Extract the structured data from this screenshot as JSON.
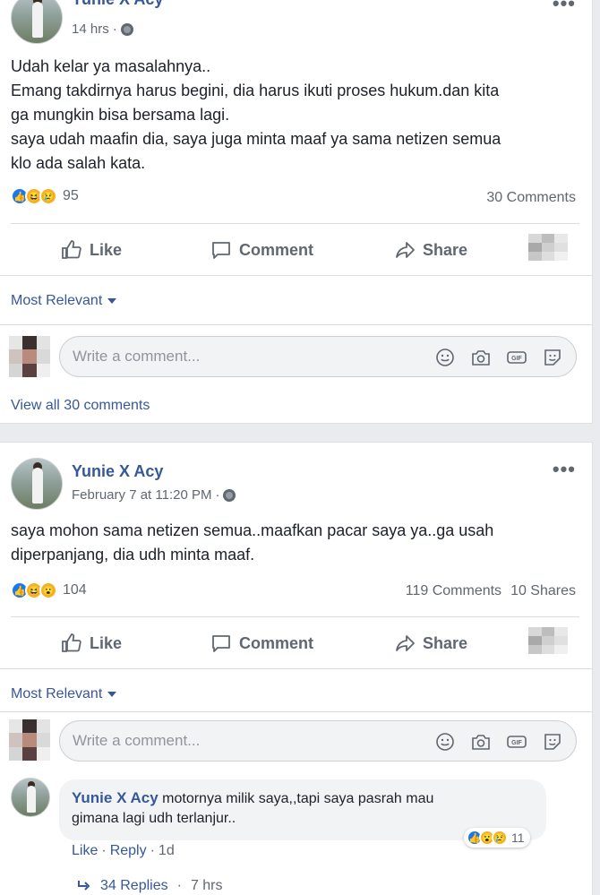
{
  "post1": {
    "author": "Yunie X Acy",
    "time": "14 hrs",
    "more": "•••",
    "body": [
      "Udah kelar ya masalahnya..",
      "Emang takdirnya harus begini, dia harus ikuti proses hukum.dan kita",
      "ga mungkin bisa bersama lagi.",
      "saya udah maafin dia, saya juga minta maaf ya sama netizen semua",
      "klo ada salah kata."
    ],
    "reaction_count": "95",
    "comments_count": "30 Comments",
    "actions": {
      "like": "Like",
      "comment": "Comment",
      "share": "Share"
    },
    "sort_label": "Most Relevant",
    "comment_placeholder": "Write a comment...",
    "view_all": "View all 30 comments"
  },
  "post2": {
    "author": "Yunie X Acy",
    "time": "February 7 at 11:20 PM",
    "more": "•••",
    "body": [
      "saya mohon sama netizen semua..maafkan pacar saya ya..ga usah",
      "diperpanjang, dia udh minta maaf."
    ],
    "reaction_count": "104",
    "comments_count": "119 Comments",
    "shares_count": "10 Shares",
    "actions": {
      "like": "Like",
      "comment": "Comment",
      "share": "Share"
    },
    "sort_label": "Most Relevant",
    "comment_placeholder": "Write a comment...",
    "reply": {
      "author": "Yunie X Acy",
      "text_line1": "motornya milik saya,,tapi saya pasrah mau",
      "text_line2": "gimana lagi udh terlanjur..",
      "reaction_count": "11",
      "like": "Like",
      "reply": "Reply",
      "time": "1d",
      "replies_label": "34 Replies",
      "replies_time": "7 hrs"
    }
  },
  "colors": {
    "link": "#365899",
    "like_blue": "#1877f2",
    "emoji_yellow": "#f7b125"
  }
}
